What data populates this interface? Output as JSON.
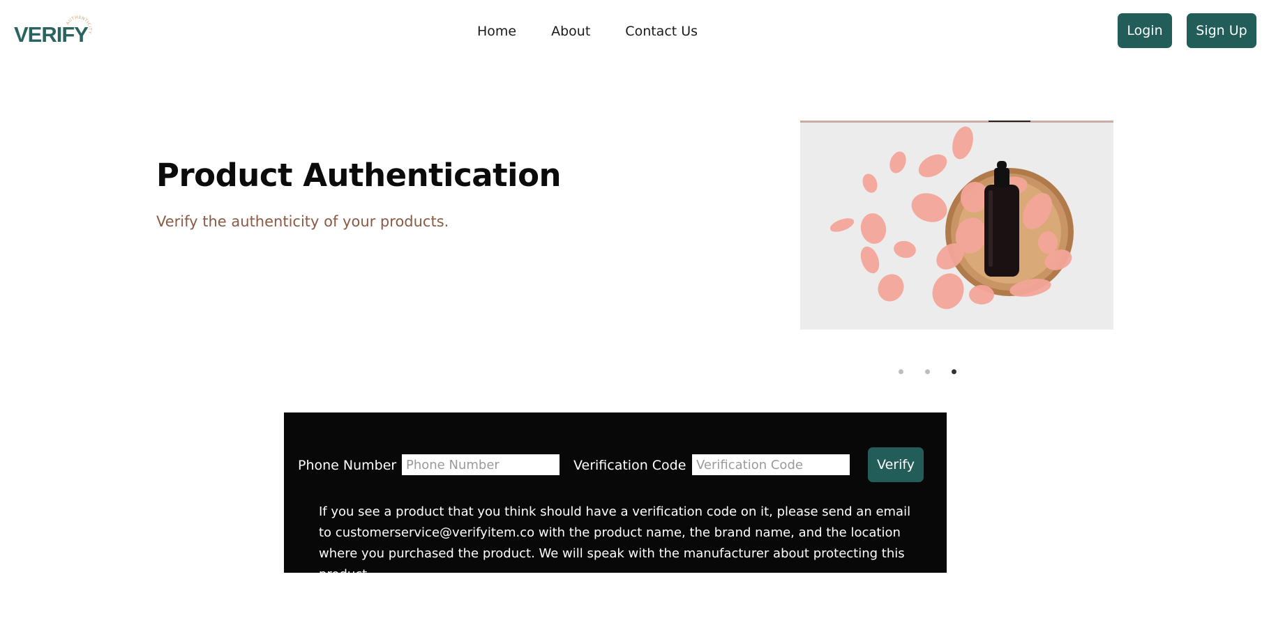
{
  "header": {
    "logo": {
      "text": "VERIFY",
      "arc_text": "AUTHENTICITY"
    },
    "nav": [
      {
        "label": "Home"
      },
      {
        "label": "About"
      },
      {
        "label": "Contact Us"
      }
    ],
    "login_label": "Login",
    "signup_label": "Sign Up"
  },
  "hero": {
    "title": "Product Authentication",
    "subtitle": "Verify the authenticity of your products.",
    "carousel": {
      "image_icon": "serum-bottle-with-rose-petals-image",
      "slide_count": 3,
      "active_slide": 3
    }
  },
  "verify_form": {
    "phone_label": "Phone Number",
    "phone_placeholder": "Phone Number",
    "phone_value": "",
    "code_label": "Verification Code",
    "code_placeholder": "Verification Code",
    "code_value": "",
    "verify_label": "Verify",
    "note": "If you see a product that you think should have a verification code on it, please send an email to customerservice@verifyitem.co with the product name, the brand name, and the location where you purchased the product. We will speak with the manufacturer about protecting this product."
  },
  "colors": {
    "brand": "#225d59",
    "subtitle": "#8a5a44",
    "panel_bg": "#080808"
  }
}
